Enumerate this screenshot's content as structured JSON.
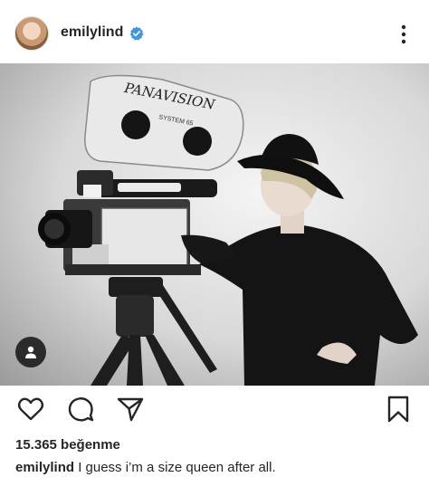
{
  "post": {
    "username": "emilylind",
    "likes_text": "15.365 beğenme",
    "caption_user": "emilylind",
    "caption_text": " I guess i’m a size queen after all.",
    "camera_brand": "PANAVISION",
    "camera_model": "SYSTEM 65"
  },
  "icons": {
    "verified": "verified-badge-icon",
    "more": "more-options-icon",
    "tag": "user-tag-icon",
    "like": "heart-icon",
    "comment": "comment-icon",
    "share": "send-icon",
    "save": "bookmark-icon"
  },
  "colors": {
    "verified_blue": "#3897f0",
    "text": "#262626"
  }
}
